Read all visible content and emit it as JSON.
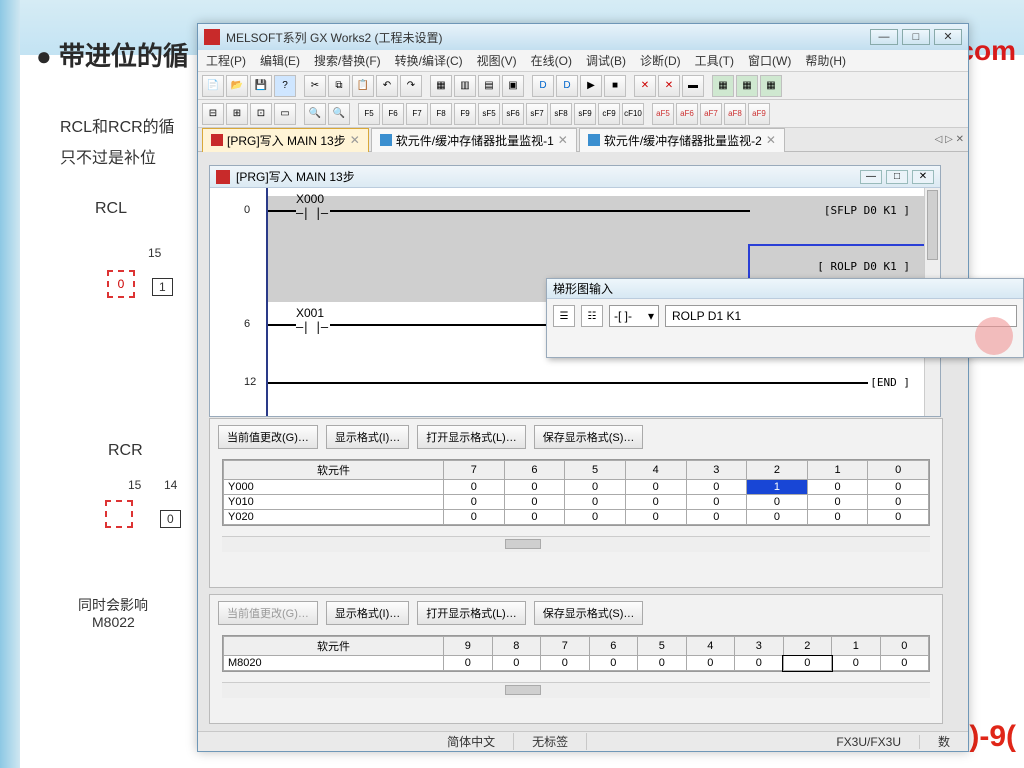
{
  "slide": {
    "bullet": "● 带进位的循",
    "line1": "RCL和RCR的循",
    "line2": "只不过是补位",
    "rcl": "RCL",
    "rcr": "RCR",
    "rcl15": "15",
    "rcl0": "0",
    "rcl1": "1",
    "rcr15": "15",
    "rcr14": "14",
    "rcr0": "0",
    "note1": "同时会影响",
    "note2": "M8022",
    "com": "com",
    "rednum": ")-9("
  },
  "app": {
    "title": "MELSOFT系列 GX Works2 (工程未设置)",
    "winmin": "—",
    "winmax": "□",
    "winclose": "✕",
    "menu": [
      "工程(P)",
      "编辑(E)",
      "搜索/替换(F)",
      "转换/编译(C)",
      "视图(V)",
      "在线(O)",
      "调试(B)",
      "诊断(D)",
      "工具(T)",
      "窗口(W)",
      "帮助(H)"
    ],
    "tabs": {
      "t1": "[PRG]写入 MAIN 13步",
      "t2": "软元件/缓冲存储器批量监视-1",
      "t3": "软元件/缓冲存储器批量监视-2",
      "nav": "◁ ▷ ✕"
    },
    "inner_title": "[PRG]写入 MAIN 13步",
    "inner_wb": {
      "a": "—",
      "b": "□",
      "c": "✕"
    },
    "ladder": {
      "step0": "0",
      "step6": "6",
      "step12": "12",
      "x000": "X000",
      "x001": "X001",
      "sflp": "[SFLP    D0       K1           ]",
      "rolp": "[ ROLP    D0       K1           ]",
      "end": "[END     ]"
    },
    "popup": {
      "title": "梯形图输入",
      "sel": "-[ ]-",
      "drop": "▾",
      "value": "ROLP D1 K1"
    },
    "panel": {
      "b_cur": "当前值更改(G)…",
      "b_fmt": "显示格式(I)…",
      "b_open": "打开显示格式(L)…",
      "b_save": "保存显示格式(S)…",
      "hdr_dev": "软元件",
      "bits8": [
        "7",
        "6",
        "5",
        "4",
        "3",
        "2",
        "1",
        "0"
      ],
      "rowsY": [
        {
          "n": "Y000",
          "b": [
            "0",
            "0",
            "0",
            "0",
            "0",
            "1",
            "0",
            "0"
          ]
        },
        {
          "n": "Y010",
          "b": [
            "0",
            "0",
            "0",
            "0",
            "0",
            "0",
            "0",
            "0"
          ]
        },
        {
          "n": "Y020",
          "b": [
            "0",
            "0",
            "0",
            "0",
            "0",
            "0",
            "0",
            "0"
          ]
        }
      ],
      "bits10": [
        "9",
        "8",
        "7",
        "6",
        "5",
        "4",
        "3",
        "2",
        "1",
        "0"
      ],
      "rowM": {
        "n": "M8020",
        "b": [
          "0",
          "0",
          "0",
          "0",
          "0",
          "0",
          "0",
          "0",
          "0",
          "0"
        ]
      }
    },
    "status": {
      "lang": "简体中文",
      "tag": "无标签",
      "plc": "FX3U/FX3U",
      "ext": "数"
    }
  }
}
